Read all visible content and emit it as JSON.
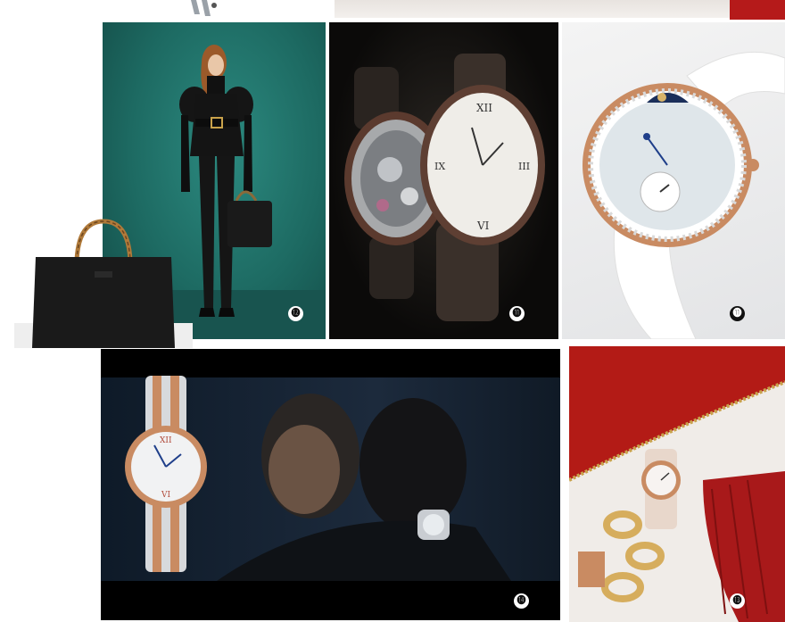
{
  "badges": {
    "fashion": "⓬",
    "watch_pair": "⓫",
    "ladies_watch": "⓫",
    "film_watch": "⓮",
    "red_bag_watch": "⓭"
  },
  "colors": {
    "teal_backdrop": "#1f6a63",
    "red_strip": "#b51a1a",
    "leather_red": "#b31b16",
    "rose_gold": "#c98b62",
    "night_blue": "#1c2a3c"
  }
}
